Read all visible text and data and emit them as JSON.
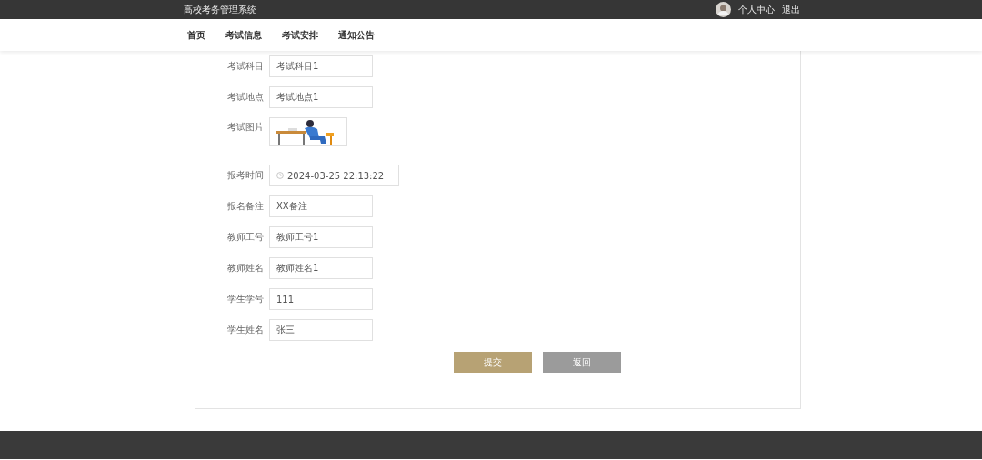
{
  "header": {
    "title": "高校考务管理系统",
    "user_links": [
      "个人中心",
      "退出"
    ]
  },
  "nav": [
    {
      "label": "首页"
    },
    {
      "label": "考试信息"
    },
    {
      "label": "考试安排"
    },
    {
      "label": "通知公告"
    }
  ],
  "form": {
    "fields": [
      {
        "kind": "text",
        "label": "考试科目",
        "value": "考试科目1"
      },
      {
        "kind": "text",
        "label": "考试地点",
        "value": "考试地点1"
      },
      {
        "label": "考试图片"
      },
      {
        "kind": "date",
        "label": "报考时间",
        "value": "2024-03-25 22:13:22"
      },
      {
        "kind": "text",
        "label": "报名备注",
        "value": "XX备注"
      },
      {
        "kind": "text",
        "label": "教师工号",
        "value": "教师工号1"
      },
      {
        "kind": "text",
        "label": "教师姓名",
        "value": "教师姓名1"
      },
      {
        "kind": "text",
        "label": "学生学号",
        "value": "111"
      },
      {
        "kind": "text",
        "label": "学生姓名",
        "value": "张三"
      }
    ],
    "buttons": [
      {
        "kind": "primary",
        "label": "提交"
      },
      {
        "kind": "secondary",
        "label": "返回"
      }
    ]
  }
}
